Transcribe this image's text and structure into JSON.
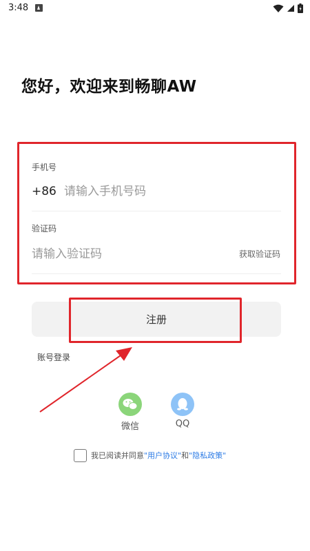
{
  "status_bar": {
    "time": "3:48",
    "icons": [
      "notification-icon",
      "wifi-icon",
      "cellular-icon",
      "battery-icon"
    ]
  },
  "welcome": {
    "title": "您好，欢迎来到畅聊AW"
  },
  "form": {
    "phone_label": "手机号",
    "country_code": "+86",
    "phone_placeholder": "请输入手机号码",
    "code_label": "验证码",
    "code_placeholder": "请输入验证码",
    "get_code": "获取验证码"
  },
  "register_button": "注册",
  "account_login": "账号登录",
  "social": [
    {
      "label": "微信",
      "icon": "wechat-icon"
    },
    {
      "label": "QQ",
      "icon": "qq-icon"
    }
  ],
  "agreement": {
    "prefix": "我已阅读并同意",
    "user_agreement": "\"用户协议\"",
    "and": "和",
    "privacy_policy": "\"隐私政策\""
  },
  "colors": {
    "highlight_red": "#e0252b",
    "link_blue": "#2c7be5",
    "wechat_green": "#8bd57a",
    "qq_blue": "#8ec3f7"
  }
}
